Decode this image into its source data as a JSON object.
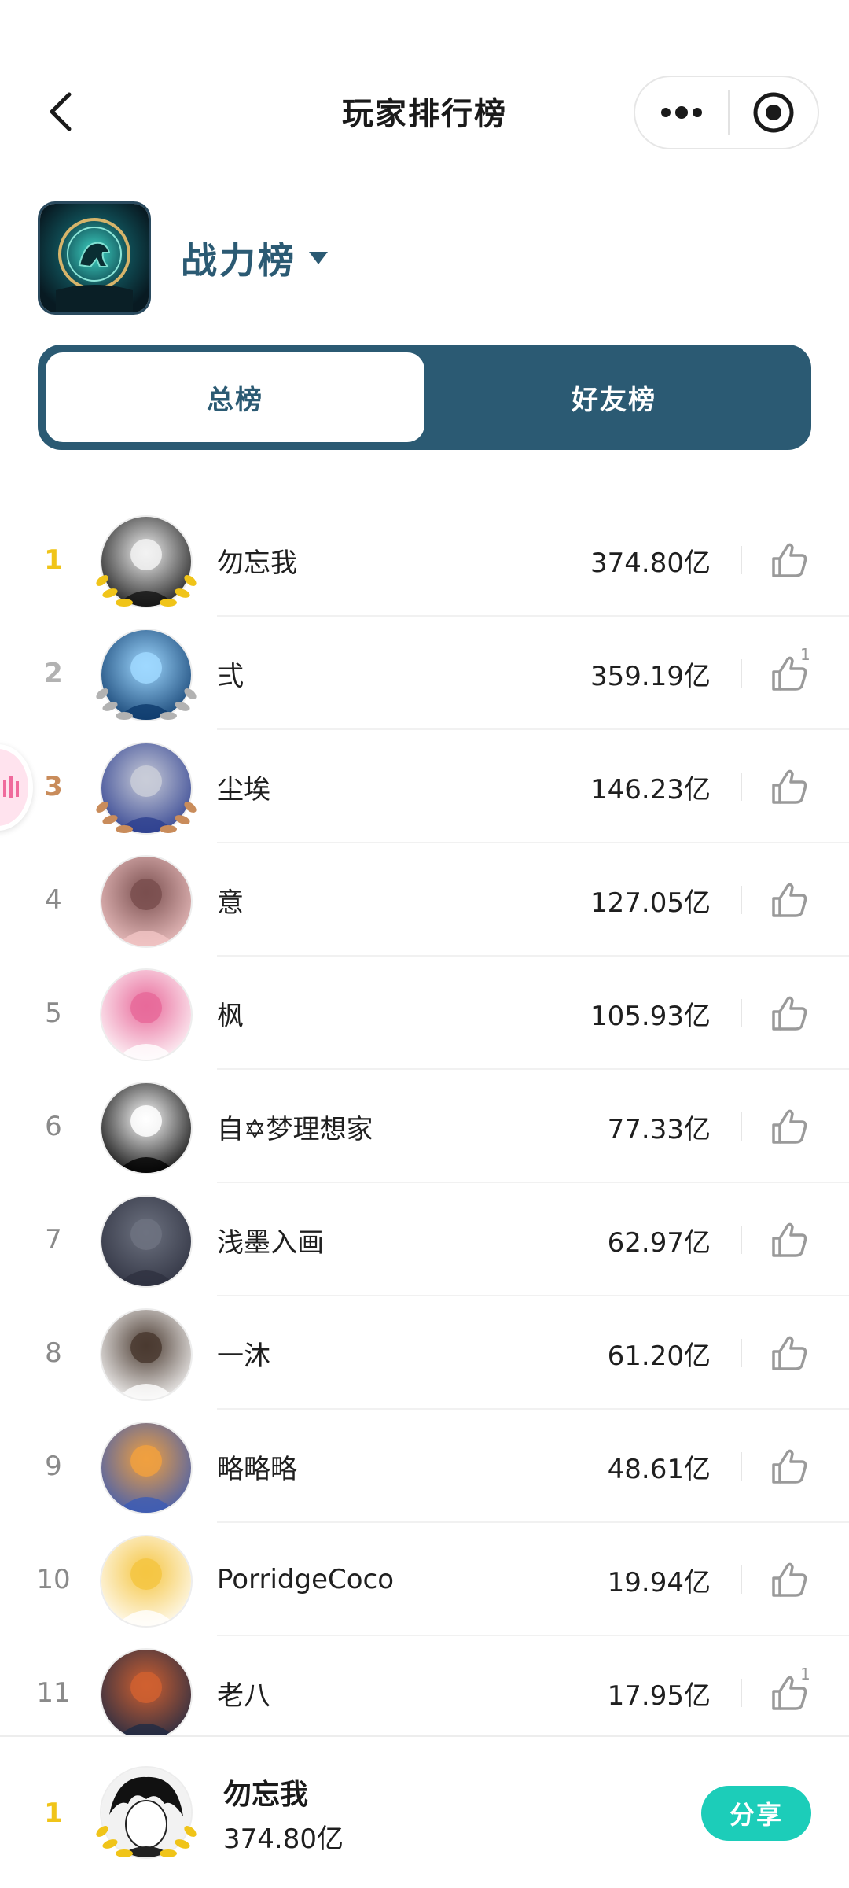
{
  "header": {
    "title": "玩家排行榜"
  },
  "game": {
    "ranking_type": "战力榜"
  },
  "tabs": [
    {
      "label": "总榜",
      "active": true
    },
    {
      "label": "好友榜",
      "active": false
    }
  ],
  "players": [
    {
      "rank": "1",
      "name": "勿忘我",
      "score": "374.80亿",
      "likes": "",
      "medal": "gold",
      "avatar_colors": [
        "#111111",
        "#f2f2f2"
      ]
    },
    {
      "rank": "2",
      "name": "弍",
      "score": "359.19亿",
      "likes": "1",
      "medal": "silver",
      "avatar_colors": [
        "#0d3a6b",
        "#9fd8ff"
      ]
    },
    {
      "rank": "3",
      "name": "尘埃",
      "score": "146.23亿",
      "likes": "",
      "medal": "bronze",
      "avatar_colors": [
        "#2c3e8f",
        "#c9ccd8"
      ]
    },
    {
      "rank": "4",
      "name": "意",
      "score": "127.05亿",
      "likes": "",
      "medal": "",
      "avatar_colors": [
        "#f2c6c6",
        "#7a4f4f"
      ]
    },
    {
      "rank": "5",
      "name": "枫",
      "score": "105.93亿",
      "likes": "",
      "medal": "",
      "avatar_colors": [
        "#ffffff",
        "#e86a9a"
      ]
    },
    {
      "rank": "6",
      "name": "自✡梦理想家",
      "score": "77.33亿",
      "likes": "",
      "medal": "",
      "avatar_colors": [
        "#000000",
        "#ffffff"
      ]
    },
    {
      "rank": "7",
      "name": "浅墨入画",
      "score": "62.97亿",
      "likes": "",
      "medal": "",
      "avatar_colors": [
        "#2e3140",
        "#6d7280"
      ]
    },
    {
      "rank": "8",
      "name": "一沐",
      "score": "61.20亿",
      "likes": "",
      "medal": "",
      "avatar_colors": [
        "#ffffff",
        "#4a3a30"
      ]
    },
    {
      "rank": "9",
      "name": "略略略",
      "score": "48.61亿",
      "likes": "",
      "medal": "",
      "avatar_colors": [
        "#3b5bb5",
        "#f0a040"
      ]
    },
    {
      "rank": "10",
      "name": "PorridgeCoco",
      "score": "19.94亿",
      "likes": "",
      "medal": "",
      "avatar_colors": [
        "#ffffff",
        "#f5c542"
      ]
    },
    {
      "rank": "11",
      "name": "老八",
      "score": "17.95亿",
      "likes": "1",
      "medal": "",
      "avatar_colors": [
        "#1f2a44",
        "#d06030"
      ]
    }
  ],
  "me": {
    "rank": "1",
    "name": "勿忘我",
    "score": "374.80亿"
  },
  "share_button": "分享",
  "colors": {
    "primary": "#2b5a73",
    "gold": "#f0c419",
    "silver": "#b2b2b2",
    "bronze": "#c98c5b",
    "share": "#1ccdb9"
  }
}
